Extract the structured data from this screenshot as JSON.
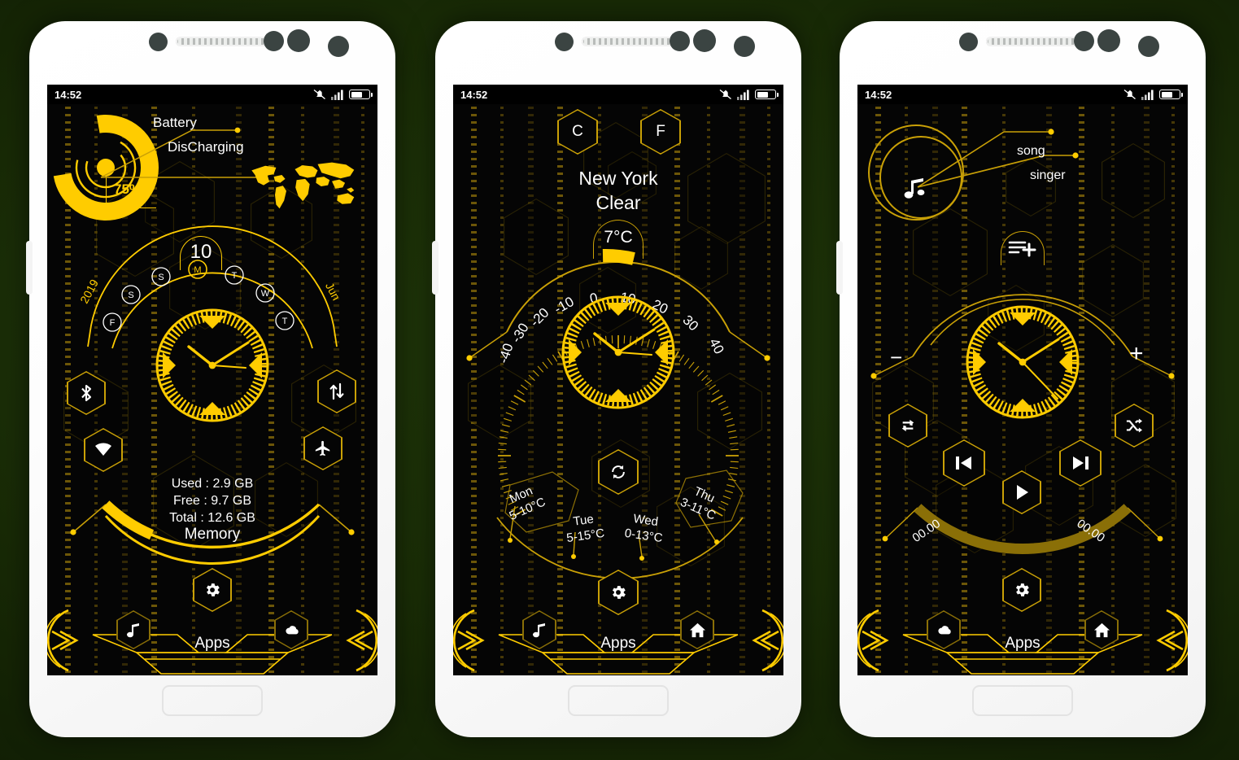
{
  "background": {
    "color": "#1b2f07"
  },
  "theme": {
    "accent": "#ffcc00",
    "accent_dim": "#c9a006",
    "screen_bg": "#050505",
    "text": "#ffffff"
  },
  "phones": [
    {
      "id": "phone-battery-clock",
      "status_bar": {
        "time": "14:52",
        "icons": [
          "mute-bell-icon",
          "signal-bars-icon",
          "battery-icon"
        ]
      },
      "battery_widget": {
        "label": "Battery",
        "state": "DisCharging",
        "percent_label": "75%",
        "percent_value": 75
      },
      "world_map": {
        "name": "world-map"
      },
      "calendar": {
        "day_number": "10",
        "year": "2019",
        "month": "Jun",
        "weekdays": [
          "F",
          "S",
          "S",
          "M",
          "T",
          "W",
          "T"
        ],
        "active_index": 3
      },
      "clock": {
        "hour": 10,
        "minute": 8,
        "second": 16
      },
      "toggles": [
        {
          "name": "bluetooth-toggle",
          "icon": "bluetooth-icon"
        },
        {
          "name": "wifi-toggle",
          "icon": "wifi-icon"
        },
        {
          "name": "data-toggle",
          "icon": "data-transfer-icon"
        },
        {
          "name": "airplane-toggle",
          "icon": "airplane-icon"
        }
      ],
      "memory": {
        "used": "Used : 2.9 GB",
        "free": "Free : 9.7 GB",
        "total": "Total : 12.6 GB",
        "label": "Memory",
        "fill_percent": 23
      },
      "settings_button": {
        "icon": "gear-icon"
      },
      "dock": {
        "label": "Apps",
        "left_arrow": "chevrons-right-icon",
        "right_arrow": "chevrons-left-icon",
        "items": [
          {
            "name": "music-shortcut",
            "icon": "music-note-icon"
          },
          {
            "name": "weather-shortcut",
            "icon": "cloud-icon"
          }
        ]
      }
    },
    {
      "id": "phone-weather",
      "status_bar": {
        "time": "14:52",
        "icons": [
          "mute-bell-icon",
          "signal-bars-icon",
          "battery-icon"
        ]
      },
      "units": [
        {
          "label": "C",
          "active": true
        },
        {
          "label": "F",
          "active": false
        }
      ],
      "weather": {
        "city": "New York",
        "condition": "Clear",
        "temperature": "7°C",
        "temp_value": 7
      },
      "thermometer": {
        "ticks": [
          "-40",
          "-30",
          "-20",
          "-10",
          "0",
          "10",
          "20",
          "30",
          "40"
        ],
        "min": -40,
        "max": 40
      },
      "clock": {
        "hour": 10,
        "minute": 8,
        "second": 16
      },
      "refresh_button": {
        "icon": "refresh-icon"
      },
      "forecast": [
        {
          "day": "Mon",
          "range": "5-10°C"
        },
        {
          "day": "Tue",
          "range": "5-15°C"
        },
        {
          "day": "Wed",
          "range": "0-13°C"
        },
        {
          "day": "Thu",
          "range": "3-11°C"
        }
      ],
      "settings_button": {
        "icon": "gear-icon"
      },
      "dock": {
        "label": "Apps",
        "left_arrow": "chevrons-right-icon",
        "right_arrow": "chevrons-left-icon",
        "items": [
          {
            "name": "music-shortcut",
            "icon": "music-note-icon"
          },
          {
            "name": "home-shortcut",
            "icon": "home-icon"
          }
        ]
      }
    },
    {
      "id": "phone-music",
      "status_bar": {
        "time": "14:52",
        "icons": [
          "mute-bell-icon",
          "signal-bars-icon",
          "battery-icon"
        ]
      },
      "now_playing": {
        "title": "song",
        "artist": "singer",
        "art_icon": "music-notes-icon"
      },
      "playlist_button": {
        "icon": "playlist-add-icon"
      },
      "volume": {
        "minus": "−",
        "plus": "+"
      },
      "clock": {
        "hour": 10,
        "minute": 8,
        "second": 16
      },
      "controls": [
        {
          "name": "repeat-button",
          "icon": "repeat-icon"
        },
        {
          "name": "previous-button",
          "icon": "skip-previous-icon"
        },
        {
          "name": "play-button",
          "icon": "play-icon"
        },
        {
          "name": "next-button",
          "icon": "skip-next-icon"
        },
        {
          "name": "shuffle-button",
          "icon": "shuffle-icon"
        }
      ],
      "progress": {
        "elapsed": "00.00",
        "remaining": "00.00",
        "percent": 0
      },
      "settings_button": {
        "icon": "gear-icon"
      },
      "dock": {
        "label": "Apps",
        "left_arrow": "chevrons-right-icon",
        "right_arrow": "chevrons-left-icon",
        "items": [
          {
            "name": "weather-shortcut",
            "icon": "cloud-icon"
          },
          {
            "name": "home-shortcut",
            "icon": "home-icon"
          }
        ]
      }
    }
  ]
}
